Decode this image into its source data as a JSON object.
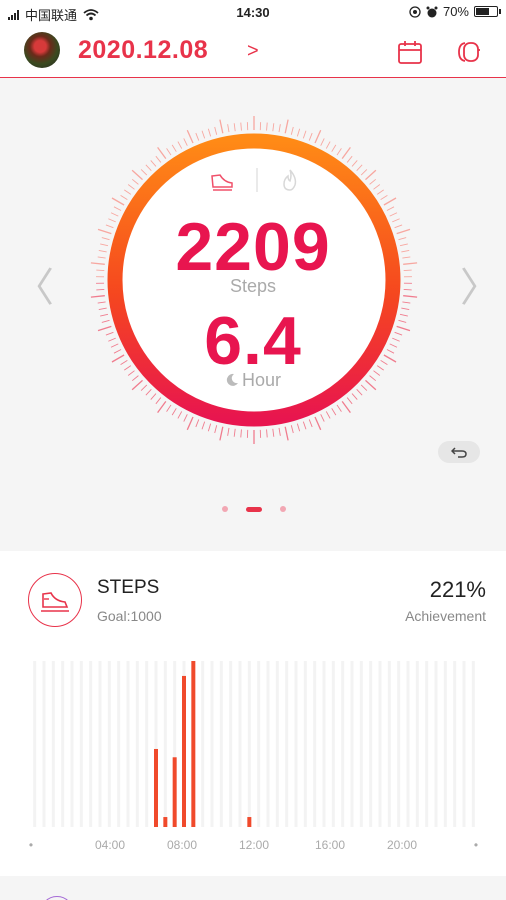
{
  "status_bar": {
    "carrier": "中国联通",
    "time": "14:30",
    "battery": "70%",
    "battery_level": 0.7
  },
  "header": {
    "date": "2020.12.08",
    "date_chevron": ">",
    "icons": [
      "calendar-icon",
      "watch-icon"
    ]
  },
  "dial": {
    "tabs": [
      "shoe-icon",
      "flame-icon"
    ],
    "steps_value": "2209",
    "steps_label": "Steps",
    "sleep_value": "6.4",
    "sleep_label": "Hour",
    "nav_left": "〈",
    "nav_right": "〉",
    "page_count": 3,
    "active_page": 2
  },
  "steps_card": {
    "title": "STEPS",
    "goal": "Goal:1000",
    "achievement_value": "221%",
    "achievement_label": "Achievement"
  },
  "chart_data": {
    "type": "bar",
    "x_ticks": [
      "•",
      "04:00",
      "08:00",
      "12:00",
      "16:00",
      "20:00",
      "•"
    ],
    "bar_slots": 48,
    "active_bars": [
      {
        "slot": 13,
        "value": 0.47
      },
      {
        "slot": 14,
        "value": 0.06
      },
      {
        "slot": 15,
        "value": 0.42
      },
      {
        "slot": 16,
        "value": 0.91
      },
      {
        "slot": 17,
        "value": 1.0
      },
      {
        "slot": 23,
        "value": 0.06
      }
    ],
    "colors": {
      "bar": "#f04a2c",
      "background_bar": "#f3f3f3"
    }
  }
}
